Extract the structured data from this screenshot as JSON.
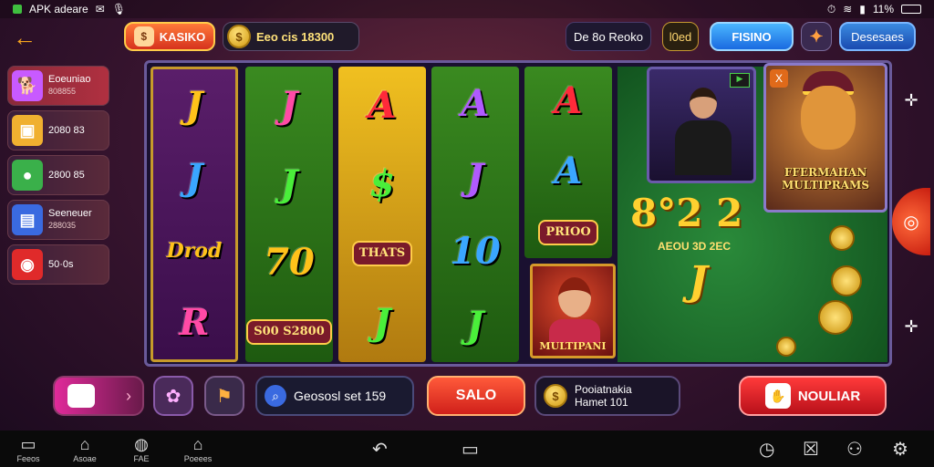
{
  "status_bar": {
    "app_name": "APK adeare",
    "battery": "11%",
    "time": ""
  },
  "header": {
    "back_icon": "arrow-left-icon",
    "kasino_label": "KASIKO",
    "balance_coin": "$",
    "balance_text": "Eeo cis  18300",
    "btn_dark1": "De 8o Reoko",
    "btn_dark2": "l0ed",
    "btn_blue": "FISINO",
    "btn_blue2": "Desesaes"
  },
  "sidebar": {
    "items": [
      {
        "label": "Eoeuniao",
        "sub": "808855",
        "icon": "dog-icon",
        "icon_color": "#c85aff"
      },
      {
        "label": "2080 83",
        "sub": "",
        "icon": "briefcase-icon",
        "icon_color": "#f0b030"
      },
      {
        "label": "2800 85",
        "sub": "",
        "icon": "circle-icon",
        "icon_color": "#3ab04a"
      },
      {
        "label": "Seeneuer",
        "sub": "288035",
        "icon": "book-icon",
        "icon_color": "#3a6ae0"
      },
      {
        "label": "50·0s",
        "sub": "",
        "icon": "chip-icon",
        "icon_color": "#e02a2a"
      }
    ]
  },
  "reels": [
    {
      "style": "purple",
      "symbols": [
        {
          "t": "J",
          "c": "gold"
        },
        {
          "t": "J",
          "c": "blue"
        },
        {
          "t": "Drod",
          "c": "gold",
          "small": true
        },
        {
          "t": "R",
          "c": "pink"
        }
      ]
    },
    {
      "style": "green",
      "symbols": [
        {
          "t": "J",
          "c": "pink"
        },
        {
          "t": "J",
          "c": "green"
        },
        {
          "t": "70",
          "c": "gold"
        },
        {
          "t": "S00 S2800",
          "c": "gold",
          "badge": true
        }
      ]
    },
    {
      "style": "gold",
      "symbols": [
        {
          "t": "A",
          "c": "red"
        },
        {
          "t": "$",
          "c": "green"
        },
        {
          "t": "THATS",
          "c": "gold",
          "badge": true
        },
        {
          "t": "J",
          "c": "green"
        }
      ]
    },
    {
      "style": "green",
      "symbols": [
        {
          "t": "A",
          "c": "purple"
        },
        {
          "t": "J",
          "c": "purple"
        },
        {
          "t": "10",
          "c": "blue"
        },
        {
          "t": "J",
          "c": "green"
        }
      ]
    },
    {
      "style": "green",
      "symbols": [
        {
          "t": "A",
          "c": "red"
        },
        {
          "t": "A",
          "c": "blue"
        },
        {
          "t": "PRIOO",
          "c": "gold",
          "badge": true
        }
      ]
    }
  ],
  "promo": {
    "label": "MULTIPANI"
  },
  "lion_card": {
    "title": "FFERMAHAN MULTIPRAMS",
    "corner": "X"
  },
  "table": {
    "big_num": "8°2 2",
    "sub": "AEOU 3D 2EC",
    "j": "J"
  },
  "controls": {
    "search_text": "Geososl set 159",
    "salo": "SALO",
    "info_line1": "Pooiatnakia",
    "info_line2": "Hamet 101",
    "nouv": "NOULIAR"
  },
  "navbar": {
    "items": [
      {
        "label": "Feeos",
        "icon": "screen-icon"
      },
      {
        "label": "Asoae",
        "icon": "home-icon"
      },
      {
        "label": "FAE",
        "icon": "ball-icon"
      },
      {
        "label": "Poeees",
        "icon": "house-icon"
      }
    ]
  },
  "colors": {
    "accent": "#ffcc4a",
    "frame": "#6a5a9a"
  }
}
